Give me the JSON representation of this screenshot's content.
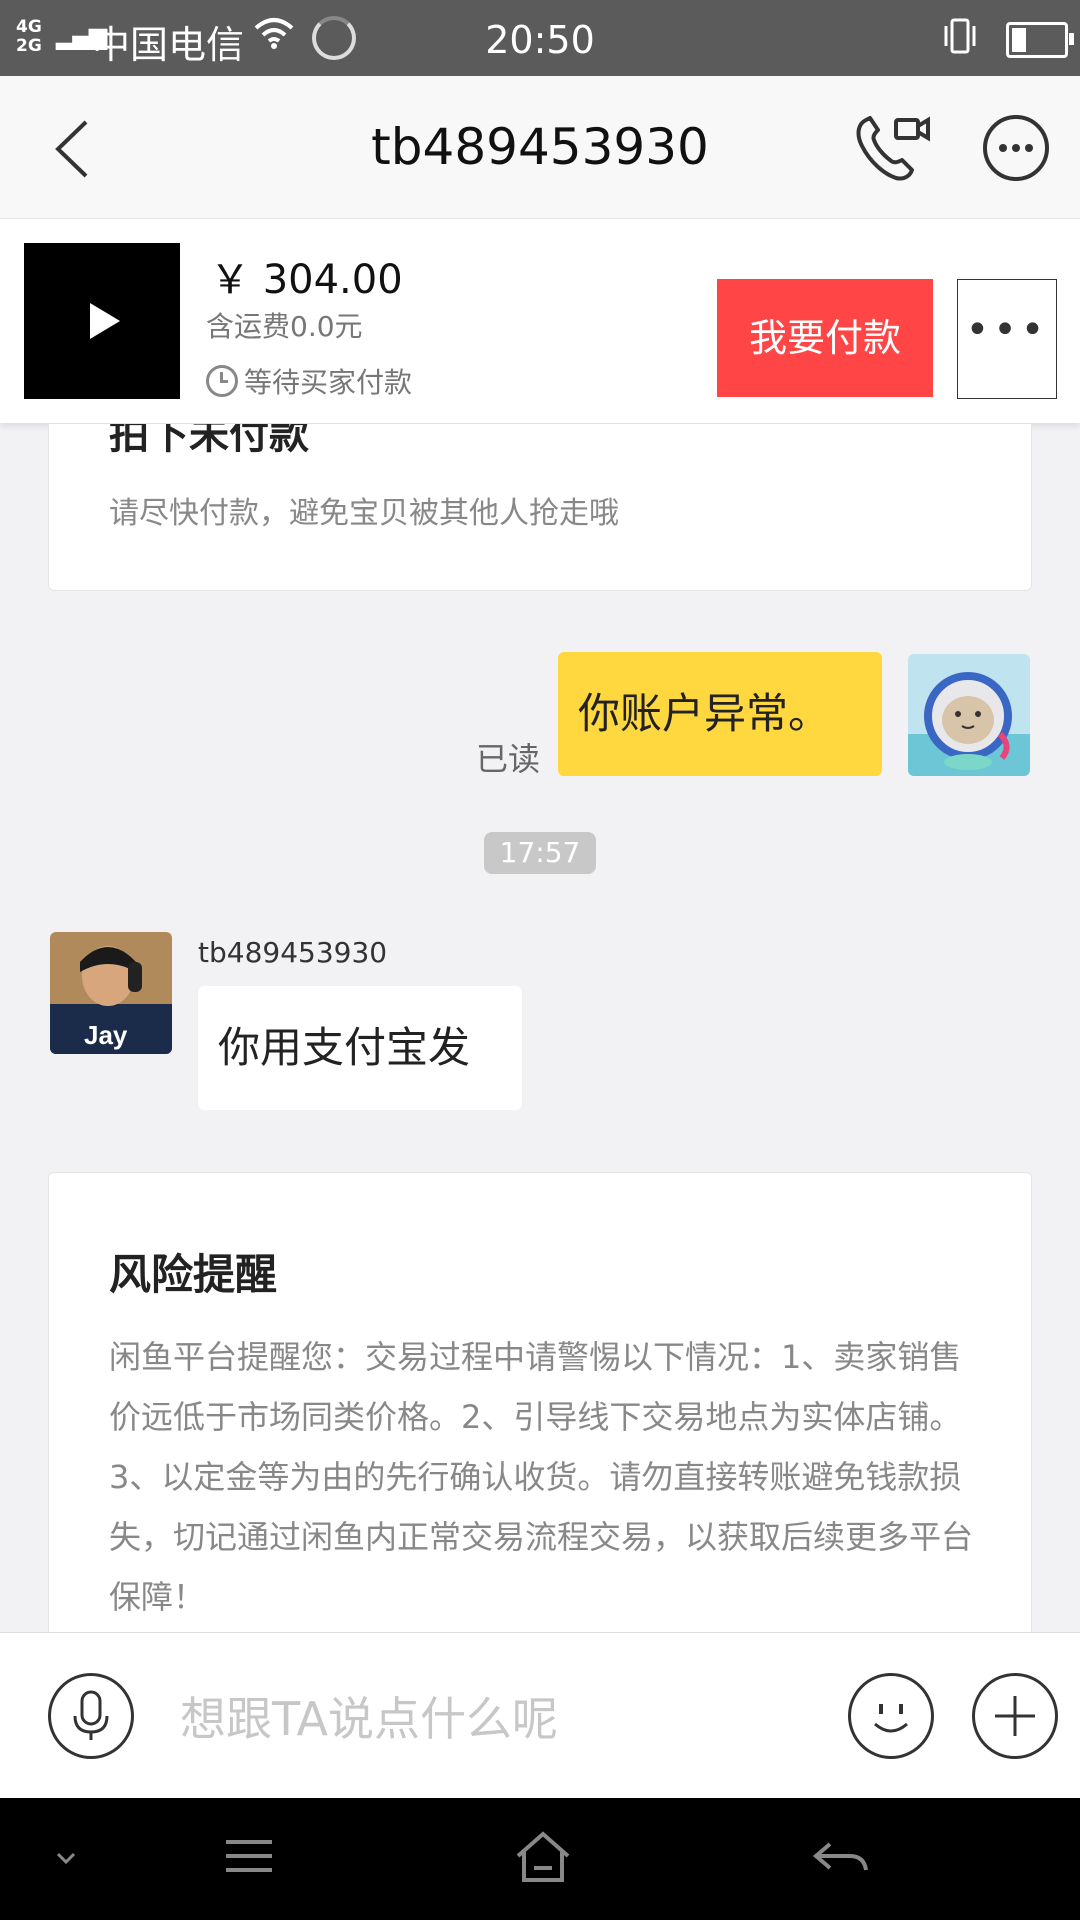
{
  "status_bar": {
    "network": "4G\n2G",
    "carrier": "中国电信",
    "time": "20:50"
  },
  "header": {
    "title": "tb489453930"
  },
  "order": {
    "price": "￥ 304.00",
    "shipping": "含运费0.0元",
    "status": "等待买家付款",
    "pay_label": "我要付款",
    "more_label": "•••"
  },
  "notice_card": {
    "title": "拍下未付款",
    "text": "请尽快付款，避免宝贝被其他人抢走哦"
  },
  "messages": {
    "mine": {
      "text": "你账户异常。",
      "read_status": "已读"
    },
    "timestamp": "17:57",
    "other": {
      "sender": "tb489453930",
      "text": "你用支付宝发"
    }
  },
  "risk_card": {
    "title": "风险提醒",
    "text": "闲鱼平台提醒您：交易过程中请警惕以下情况：1、卖家销售价远低于市场同类价格。2、引导线下交易地点为实体店铺。3、以定金等为由的先行确认收货。请勿直接转账避免钱款损失，切记通过闲鱼内正常交易流程交易，以获取后续更多平台保障！"
  },
  "input_bar": {
    "placeholder": "想跟TA说点什么呢"
  },
  "avatar_text": {
    "other": "Jay"
  },
  "colors": {
    "pay_button": "#ff4545",
    "my_bubble": "#ffd840",
    "background": "#f2f2f5"
  }
}
